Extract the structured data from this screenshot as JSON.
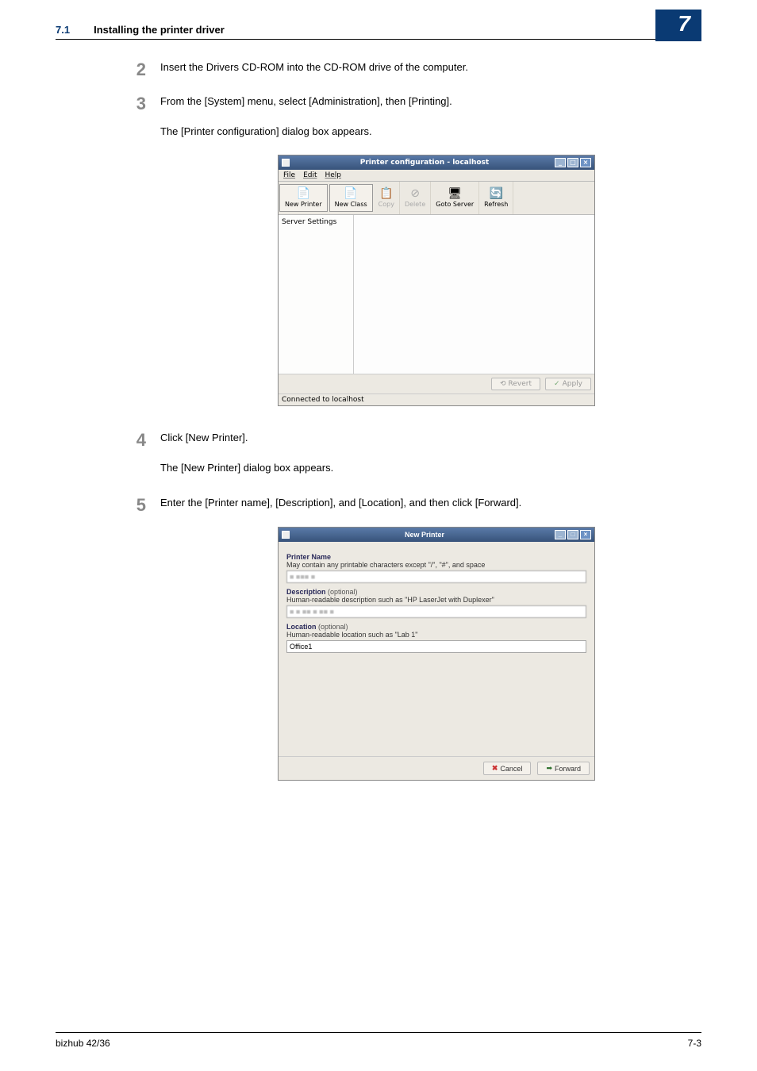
{
  "header": {
    "section_num": "7.1",
    "section_title": "Installing the printer driver",
    "chapter_badge": "7"
  },
  "steps": {
    "s2": {
      "num": "2",
      "text": "Insert the Drivers CD-ROM into the CD-ROM drive of the computer."
    },
    "s3": {
      "num": "3",
      "text": "From the [System] menu, select [Administration], then [Printing].",
      "sub": "The [Printer configuration] dialog box appears."
    },
    "s4": {
      "num": "4",
      "text": "Click [New Printer].",
      "sub": "The [New Printer] dialog box appears."
    },
    "s5": {
      "num": "5",
      "text": "Enter the [Printer name], [Description], and [Location], and then click [Forward]."
    }
  },
  "win1": {
    "title": "Printer configuration - localhost",
    "menu": {
      "file": "File",
      "edit": "Edit",
      "help": "Help"
    },
    "toolbar": {
      "new_printer": "New Printer",
      "new_class": "New Class",
      "copy": "Copy",
      "delete": "Delete",
      "goto": "Goto Server",
      "refresh": "Refresh"
    },
    "side_item": "Server Settings",
    "btn_revert": "Revert",
    "btn_apply": "Apply",
    "status": "Connected to localhost"
  },
  "win2": {
    "title": "New Printer",
    "name_label": "Printer Name",
    "name_hint": "May contain any printable characters except \"/\", \"#\", and space",
    "desc_label": "Description",
    "optional": " (optional)",
    "desc_hint": "Human-readable description such as \"HP LaserJet with Duplexer\"",
    "loc_label": "Location",
    "loc_hint": "Human-readable location such as \"Lab 1\"",
    "loc_value": "Office1",
    "btn_cancel": "Cancel",
    "btn_forward": "Forward"
  },
  "footer": {
    "left": "bizhub 42/36",
    "right": "7-3"
  }
}
